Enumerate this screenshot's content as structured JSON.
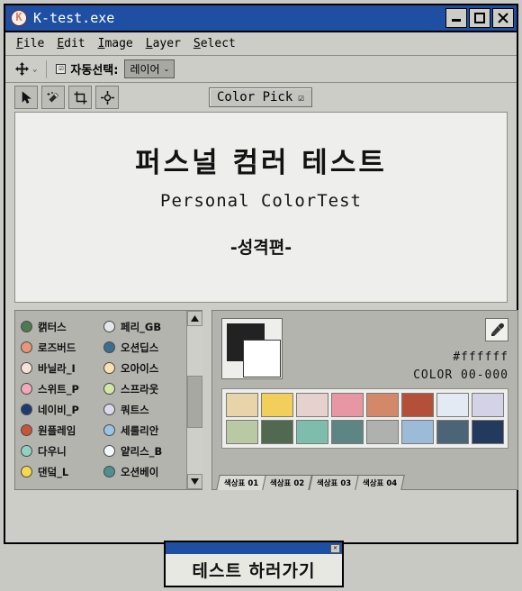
{
  "window": {
    "title": "K-test.exe",
    "icon": "app-k-icon",
    "icon_letter": "K",
    "controls": [
      {
        "name": "minimize-button",
        "glyph": "minimize"
      },
      {
        "name": "maximize-button",
        "glyph": "maximize"
      },
      {
        "name": "close-button",
        "glyph": "close"
      }
    ]
  },
  "menubar": {
    "items": [
      {
        "accel": "F",
        "rest": "ile"
      },
      {
        "accel": "E",
        "rest": "dit"
      },
      {
        "accel": "I",
        "rest": "mage"
      },
      {
        "accel": "L",
        "rest": "ayer"
      },
      {
        "accel": "S",
        "rest": "elect"
      }
    ]
  },
  "options_bar": {
    "move_tool_icon": "move-tool-icon",
    "move_tool_caret": "⌄",
    "autoselect_checkbox_checked": true,
    "autoselect_check_glyph": "☑",
    "autoselect_label": "자동선택:",
    "layer_dropdown_value": "레이어",
    "layer_dropdown_caret": "⌄"
  },
  "toolbar": {
    "tools": [
      {
        "name": "pointer-tool",
        "icon": "cursor-arrow-icon"
      },
      {
        "name": "magic-wand-tool",
        "icon": "magic-wand-icon"
      },
      {
        "name": "crop-tool",
        "icon": "crop-icon"
      },
      {
        "name": "move-target-tool",
        "icon": "move-target-icon"
      }
    ],
    "colorpick_label": "Color Pick",
    "colorpick_check_glyph": "☑"
  },
  "canvas": {
    "title": "퍼스널 컴러 테스트",
    "subtitle": "Personal ColorTest",
    "note": "-성격편-"
  },
  "color_list": {
    "left_column": [
      {
        "label": "캙터스",
        "color": "#4e7a53"
      },
      {
        "label": "로즈버드",
        "color": "#e8957a"
      },
      {
        "label": "바닐라_I",
        "color": "#f6e2d8"
      },
      {
        "label": "스위트_P",
        "color": "#f3a9bb"
      },
      {
        "label": "네이비_P",
        "color": "#1e3a75"
      },
      {
        "label": "원플레임",
        "color": "#c8553b"
      },
      {
        "label": "다우니",
        "color": "#8fd2c3"
      },
      {
        "label": "댄덬_L",
        "color": "#f7d84a"
      }
    ],
    "right_column": [
      {
        "label": "페리_GB",
        "color": "#e2e7ea"
      },
      {
        "label": "오션딥스",
        "color": "#3d6e90"
      },
      {
        "label": "오아이스",
        "color": "#fbe0b0"
      },
      {
        "label": "스프라웃",
        "color": "#d2e8a8"
      },
      {
        "label": "쿼트스",
        "color": "#ded8ef"
      },
      {
        "label": "세룰리안",
        "color": "#9ac4e2"
      },
      {
        "label": "얕리스_B",
        "color": "#f4f9fd"
      },
      {
        "label": "오션베이",
        "color": "#4e8f92"
      }
    ],
    "scrollbar": {
      "up_glyph": "▲",
      "down_glyph": "▼"
    }
  },
  "color_picker": {
    "foreground_color": "#222222",
    "background_color": "#ffffff",
    "eyedropper_icon": "eyedropper-icon",
    "hex_value": "#ffffff",
    "color_code": "COLOR 00-000",
    "swatch_rows": [
      [
        "#e8d4ab",
        "#f2ce5a",
        "#e5d1cd",
        "#e996a4",
        "#d4886a",
        "#b4503a",
        "#e4eaf3",
        "#d4d2e6"
      ],
      [
        "#b8c9a3",
        "#50694f",
        "#7ebdab",
        "#5d8583",
        "#afb1ae",
        "#9bbbd9",
        "#4c6477",
        "#23395e"
      ]
    ],
    "tabs": [
      {
        "label": "색상표 01",
        "active": true
      },
      {
        "label": "색상표 02",
        "active": false
      },
      {
        "label": "색상표 03",
        "active": false
      },
      {
        "label": "색상표 04",
        "active": false
      }
    ]
  },
  "dialog": {
    "close_glyph": "✕",
    "text": "테스트 하러가기"
  }
}
